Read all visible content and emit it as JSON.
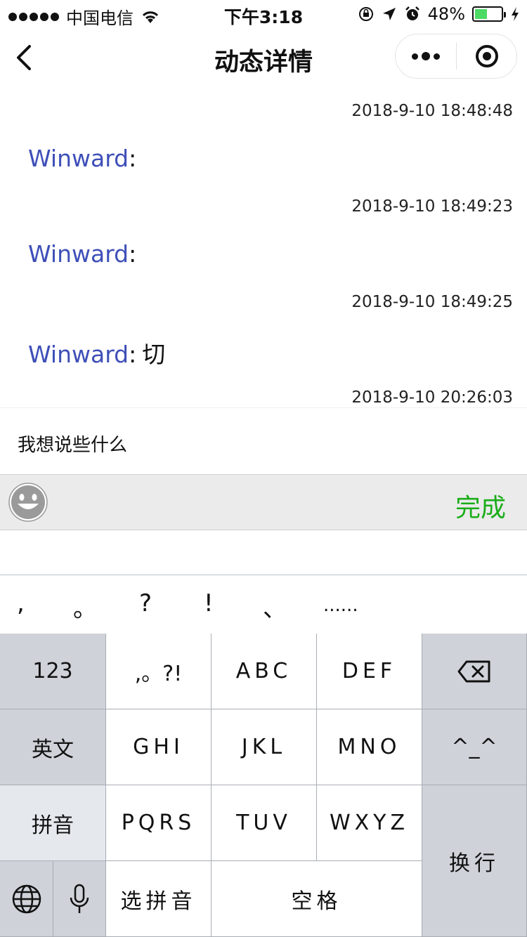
{
  "status_bar": {
    "carrier": "中国电信",
    "time": "下午3:18",
    "battery_percent": "48%",
    "battery_level": 0.48
  },
  "nav": {
    "title": "动态详情"
  },
  "messages": [
    {
      "time": "2018-9-10 18:48:48",
      "name": "Winward",
      "colon": ":",
      "text": ""
    },
    {
      "time": "2018-9-10 18:49:23",
      "name": "Winward",
      "colon": ":",
      "text": ""
    },
    {
      "time": "2018-9-10 18:49:25",
      "name": "Winward",
      "colon": ":",
      "text": "切"
    },
    {
      "time": "2018-9-10 20:26:03"
    }
  ],
  "input": {
    "value": "我想说些什么"
  },
  "toolbar": {
    "done_label": "完成"
  },
  "punctuation": [
    ",",
    "。",
    "?",
    "!",
    "、",
    "......"
  ],
  "keyboard": {
    "row1": [
      "123",
      ",。?!",
      "ABC",
      "DEF"
    ],
    "row2": [
      "英文",
      "GHI",
      "JKL",
      "MNO",
      "^_^"
    ],
    "row3": [
      "拼音",
      "PQRS",
      "TUV",
      "WXYZ"
    ],
    "row4": [
      "选拼音",
      "空格"
    ],
    "enter": "换行",
    "delete_icon": "backspace-icon",
    "globe_icon": "globe-icon",
    "mic_icon": "microphone-icon"
  },
  "colors": {
    "name": "#3e4fb8",
    "done": "#1aad19",
    "battery": "#4cd964"
  }
}
